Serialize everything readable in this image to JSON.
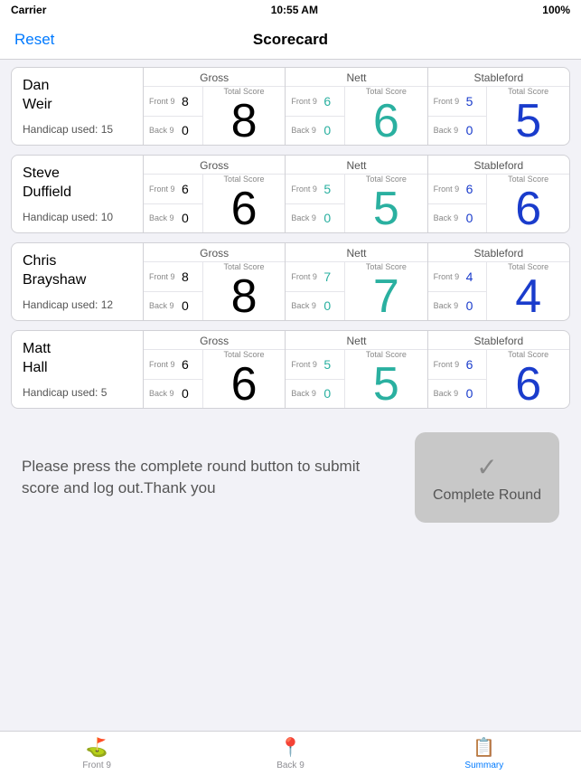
{
  "status_bar": {
    "carrier": "Carrier",
    "wifi_icon": "wifi",
    "time": "10:55 AM",
    "battery": "100%"
  },
  "nav": {
    "reset_label": "Reset",
    "title": "Scorecard"
  },
  "players": [
    {
      "id": "player-1",
      "name_line1": "Dan",
      "name_line2": "Weir",
      "handicap": "Handicap used: 15",
      "gross": {
        "front9": "8",
        "back9": "0",
        "total": "8"
      },
      "nett": {
        "front9": "6",
        "back9": "0",
        "total": "6"
      },
      "stableford": {
        "front9": "5",
        "back9": "0",
        "total": "5"
      }
    },
    {
      "id": "player-2",
      "name_line1": "Steve",
      "name_line2": "Duffield",
      "handicap": "Handicap used: 10",
      "gross": {
        "front9": "6",
        "back9": "0",
        "total": "6"
      },
      "nett": {
        "front9": "5",
        "back9": "0",
        "total": "5"
      },
      "stableford": {
        "front9": "6",
        "back9": "0",
        "total": "6"
      }
    },
    {
      "id": "player-3",
      "name_line1": "Chris",
      "name_line2": "Brayshaw",
      "handicap": "Handicap used: 12",
      "gross": {
        "front9": "8",
        "back9": "0",
        "total": "8"
      },
      "nett": {
        "front9": "7",
        "back9": "0",
        "total": "7"
      },
      "stableford": {
        "front9": "4",
        "back9": "0",
        "total": "4"
      }
    },
    {
      "id": "player-4",
      "name_line1": "Matt",
      "name_line2": "Hall",
      "handicap": "Handicap used: 5",
      "gross": {
        "front9": "6",
        "back9": "0",
        "total": "6"
      },
      "nett": {
        "front9": "5",
        "back9": "0",
        "total": "5"
      },
      "stableford": {
        "front9": "6",
        "back9": "0",
        "total": "6"
      }
    }
  ],
  "labels": {
    "gross": "Gross",
    "nett": "Nett",
    "stableford": "Stableford",
    "front9": "Front 9",
    "back9": "Back 9",
    "total_score": "Total Score"
  },
  "bottom": {
    "message": "Please press the complete round button to submit score and log out.Thank you",
    "complete_round": "Complete Round",
    "checkmark": "✓"
  },
  "tabs": [
    {
      "id": "front9",
      "label": "Front 9",
      "icon": "⛳",
      "active": false
    },
    {
      "id": "back9",
      "label": "Back 9",
      "icon": "📍",
      "active": false
    },
    {
      "id": "summary",
      "label": "Summary",
      "icon": "📄",
      "active": true
    }
  ]
}
